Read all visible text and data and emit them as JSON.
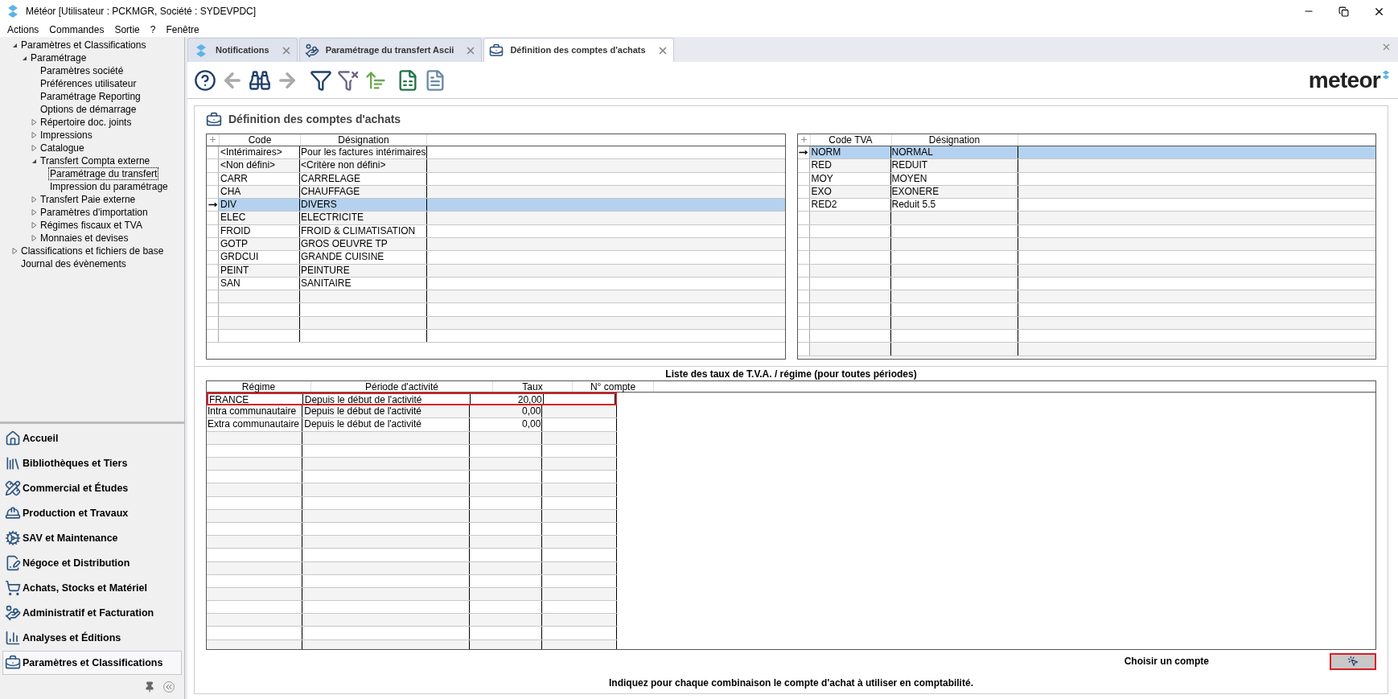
{
  "window": {
    "title": "Météor [Utilisateur : PCKMGR, Société : SYDEVPDC]"
  },
  "menu": [
    "Actions",
    "Commandes",
    "Sortie",
    "?",
    "Fenêtre"
  ],
  "tree": [
    {
      "label": "Paramètres et Classifications",
      "expanded": true,
      "children": [
        {
          "label": "Paramétrage",
          "expanded": true,
          "children": [
            {
              "label": "Paramètres société",
              "selected": false
            },
            {
              "label": "Préférences utilisateur",
              "selected": false
            },
            {
              "label": "Paramétrage Reporting",
              "selected": false
            },
            {
              "label": "Options de démarrage",
              "selected": false
            },
            {
              "label": "Répertoire doc. joints",
              "expanded": false,
              "selected": false
            },
            {
              "label": "Impressions",
              "expanded": false,
              "selected": false
            },
            {
              "label": "Catalogue",
              "expanded": false,
              "selected": false
            },
            {
              "label": "Transfert Compta externe",
              "expanded": true,
              "children": [
                {
                  "label": "Paramétrage du transfert",
                  "selected": true
                },
                {
                  "label": "Impression du paramétrage",
                  "selected": false
                }
              ]
            },
            {
              "label": "Transfert Paie externe",
              "expanded": false,
              "selected": false
            },
            {
              "label": "Paramètres d'importation",
              "expanded": false,
              "selected": false
            },
            {
              "label": "Régimes fiscaux et TVA",
              "expanded": false,
              "selected": false
            },
            {
              "label": "Monnaies et devises",
              "expanded": false,
              "selected": false
            }
          ]
        }
      ]
    },
    {
      "label": "Classifications et fichiers de base",
      "expanded": false,
      "selected": false
    },
    {
      "label": "Journal des évènements",
      "selected": false
    }
  ],
  "nav": [
    {
      "label": "Accueil",
      "selected": false
    },
    {
      "label": "Bibliothèques et Tiers",
      "selected": false
    },
    {
      "label": "Commercial et Études",
      "selected": false
    },
    {
      "label": "Production et Travaux",
      "selected": false
    },
    {
      "label": "SAV et Maintenance",
      "selected": false
    },
    {
      "label": "Négoce et Distribution",
      "selected": false
    },
    {
      "label": "Achats, Stocks et Matériel",
      "selected": false
    },
    {
      "label": "Administratif et Facturation",
      "selected": false
    },
    {
      "label": "Analyses et Éditions",
      "selected": false
    },
    {
      "label": "Paramètres et Classifications",
      "selected": true
    }
  ],
  "tabs": [
    {
      "label": "Notifications",
      "selected": false
    },
    {
      "label": "Paramétrage du transfert Ascii",
      "selected": false
    },
    {
      "label": "Définition des comptes d'achats",
      "selected": true
    }
  ],
  "logo": "meteor",
  "panel_title": "Définition des comptes d'achats",
  "categories_grid": {
    "columns": [
      "Code",
      "Désignation"
    ],
    "rows": [
      {
        "code": "<Intérimaires>",
        "designation": "Pour les factures intérimaires",
        "selected": false
      },
      {
        "code": "<Non défini>",
        "designation": "<Critère non défini>",
        "selected": false
      },
      {
        "code": "CARR",
        "designation": "CARRELAGE",
        "selected": false
      },
      {
        "code": "CHA",
        "designation": "CHAUFFAGE",
        "selected": false
      },
      {
        "code": "DIV",
        "designation": "DIVERS",
        "selected": true
      },
      {
        "code": "ELEC",
        "designation": "ELECTRICITE",
        "selected": false
      },
      {
        "code": "FROID",
        "designation": "FROID & CLIMATISATION",
        "selected": false
      },
      {
        "code": "GOTP",
        "designation": "GROS OEUVRE TP",
        "selected": false
      },
      {
        "code": "GRDCUI",
        "designation": "GRANDE CUISINE",
        "selected": false
      },
      {
        "code": "PEINT",
        "designation": "PEINTURE",
        "selected": false
      },
      {
        "code": "SAN",
        "designation": "SANITAIRE",
        "selected": false
      }
    ]
  },
  "vat_grid": {
    "columns": [
      "Code TVA",
      "Désignation"
    ],
    "rows": [
      {
        "code": "NORM",
        "designation": "NORMAL",
        "selected": true
      },
      {
        "code": "RED",
        "designation": "REDUIT",
        "selected": false
      },
      {
        "code": "MOY",
        "designation": "MOYEN",
        "selected": false
      },
      {
        "code": "EXO",
        "designation": "EXONERE",
        "selected": false
      },
      {
        "code": "RED2",
        "designation": "Reduit 5.5",
        "selected": false
      }
    ]
  },
  "rates": {
    "title": "Liste des taux de T.V.A. / régime (pour toutes périodes)",
    "columns": [
      "Régime",
      "Période d'activité",
      "Taux",
      "N° compte"
    ],
    "rows": [
      {
        "regime": "FRANCE",
        "period": "Depuis le début de l'activité",
        "rate": "20,00",
        "highlighted": true
      },
      {
        "regime": "Intra communautaire",
        "period": "Depuis le début de l'activité",
        "rate": "0,00",
        "highlighted": false
      },
      {
        "regime": "Extra communautaire",
        "period": "Depuis le début de l'activité",
        "rate": "0,00",
        "highlighted": false
      }
    ]
  },
  "choose_account": {
    "label": "Choisir un compte",
    "highlighted": true
  },
  "footer_note": "Indiquez pour chaque combinaison le compte d'achat à utiliser en comptabilité."
}
